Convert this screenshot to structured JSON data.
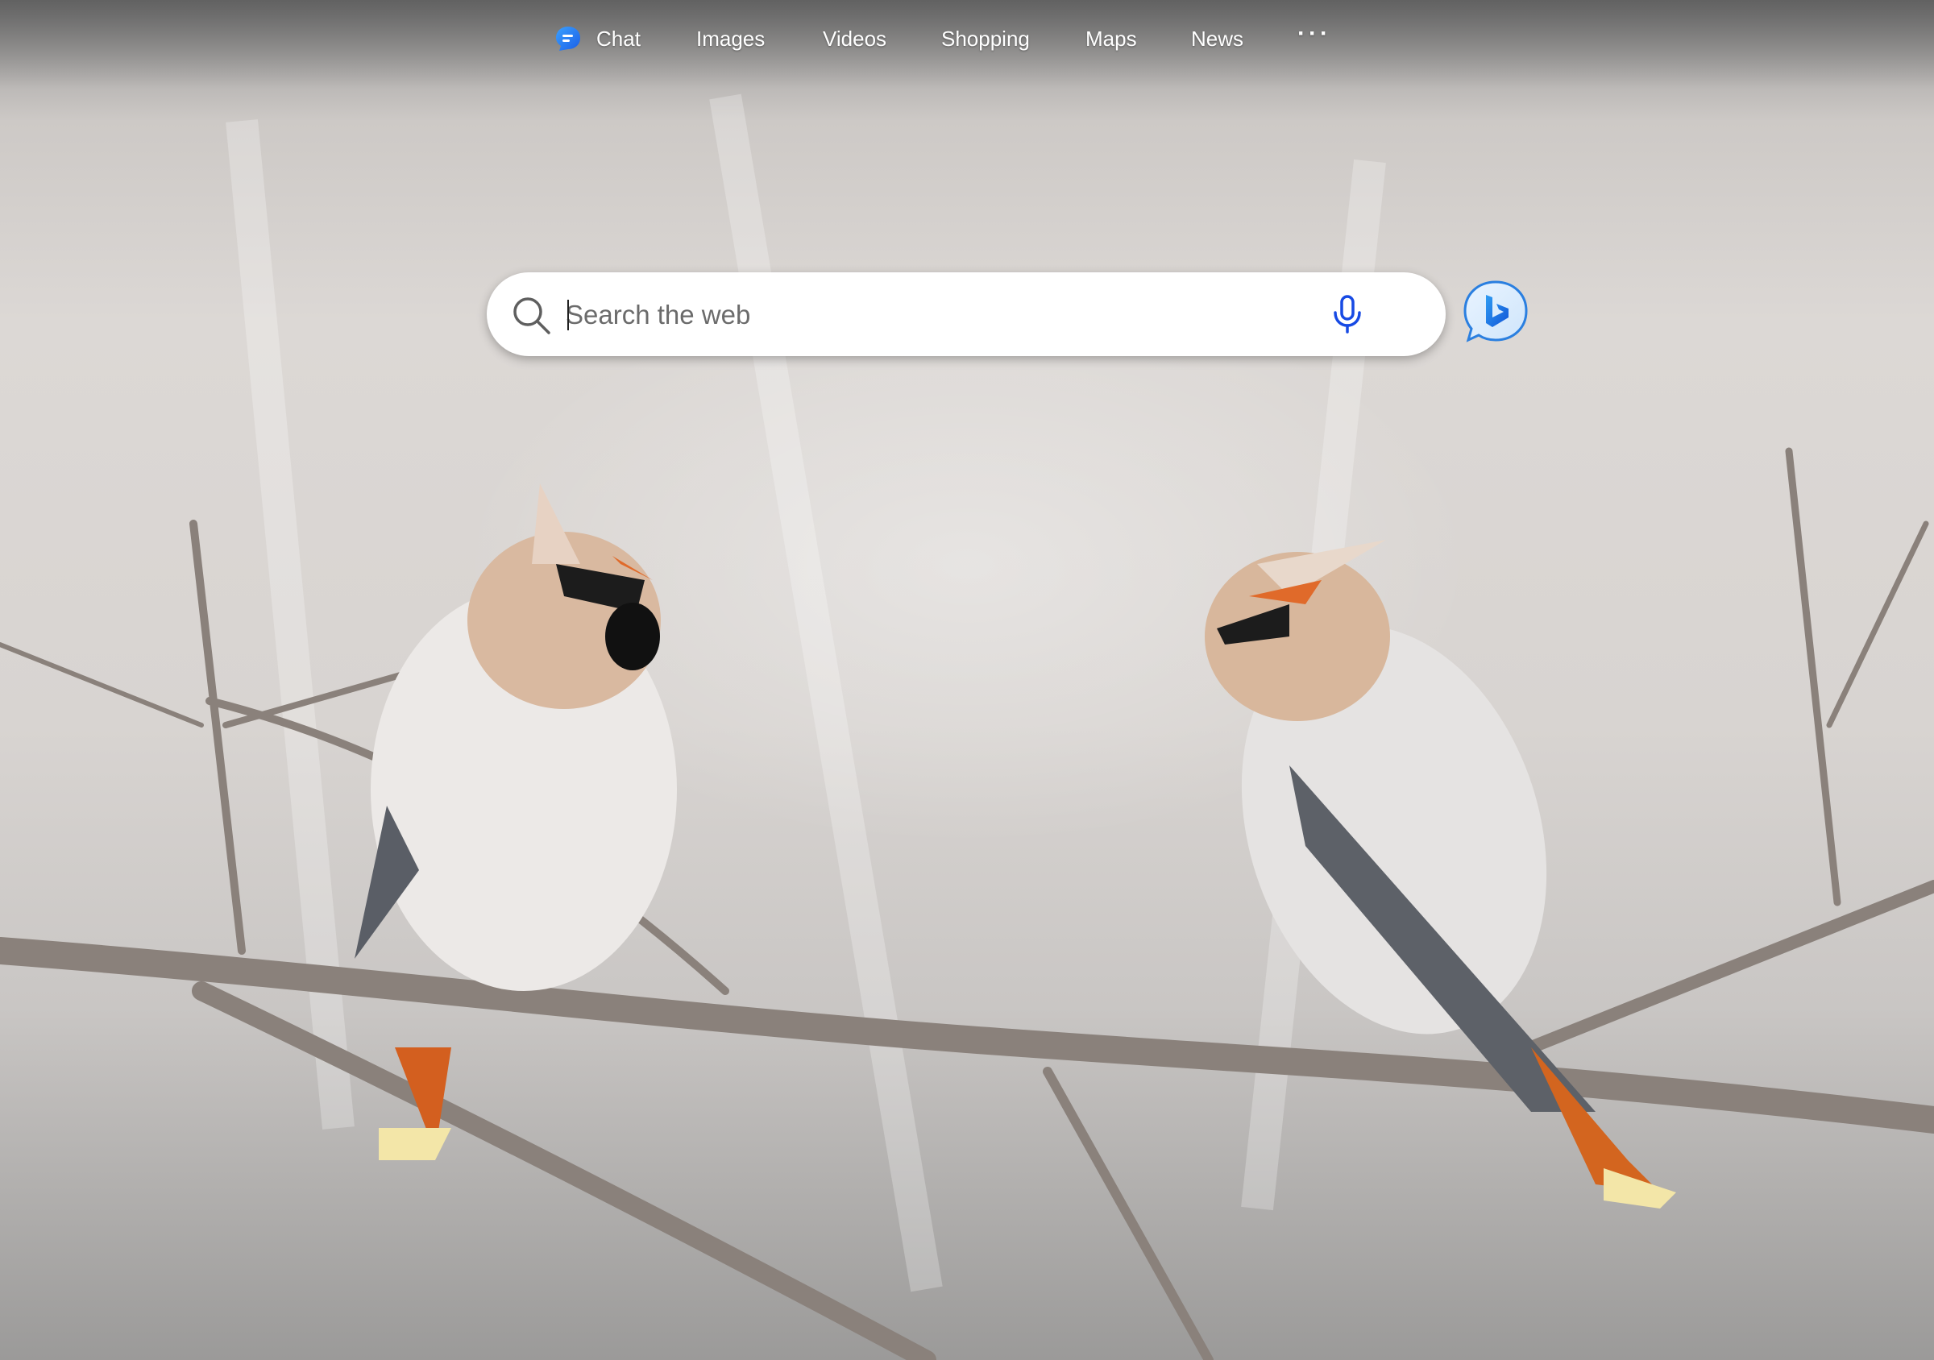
{
  "nav": {
    "items": [
      {
        "label": "Chat",
        "icon": "chat-bubble-icon"
      },
      {
        "label": "Images"
      },
      {
        "label": "Videos"
      },
      {
        "label": "Shopping"
      },
      {
        "label": "Maps"
      },
      {
        "label": "News"
      },
      {
        "label": "···"
      }
    ]
  },
  "search": {
    "placeholder": "Search the web",
    "value": ""
  },
  "icons": {
    "search": "search-icon",
    "microphone": "microphone-icon",
    "copilot": "bing-copilot-icon"
  },
  "colors": {
    "accent_blue": "#1a73e8",
    "mic_blue": "#174ae4",
    "nav_text": "#ffffff"
  }
}
